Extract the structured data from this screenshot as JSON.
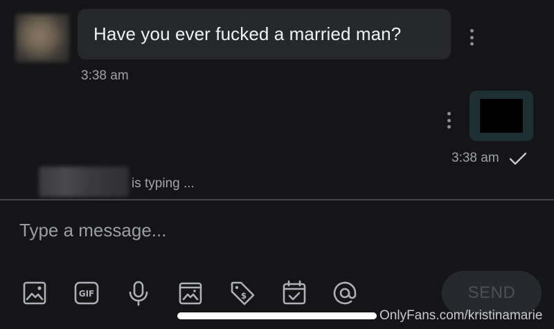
{
  "conversation": {
    "incoming": {
      "text": "Have you ever fucked a married man?",
      "time": "3:38 am"
    },
    "outgoing": {
      "time": "3:38 am",
      "status_icon": "check-icon"
    },
    "typing_indicator": "is typing ..."
  },
  "composer": {
    "placeholder": "Type a message...",
    "send_label": "SEND",
    "tools": [
      "image-icon",
      "gif-icon",
      "microphone-icon",
      "vault-icon",
      "price-tag-icon",
      "calendar-icon",
      "mention-icon"
    ]
  },
  "watermark": "OnlyFans.com/kristinamarie",
  "colors": {
    "background": "#151517",
    "bubble": "#26282c",
    "divider": "#45474b",
    "icon": "#aeb2b8"
  }
}
